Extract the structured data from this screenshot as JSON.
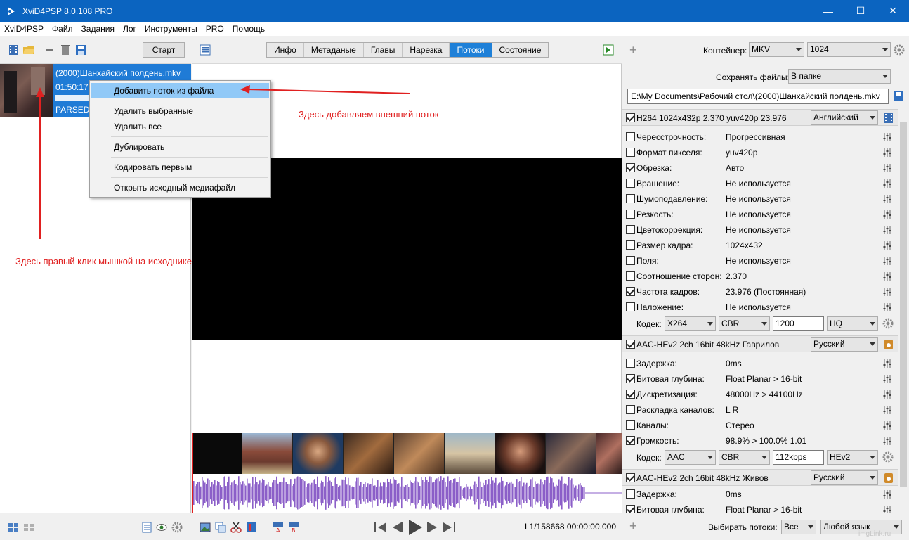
{
  "window": {
    "title": "XviD4PSP 8.0.108 PRO",
    "minimize": "—",
    "maximize": "☐",
    "close": "✕"
  },
  "menu": [
    "XviD4PSP",
    "Файл",
    "Задания",
    "Лог",
    "Инструменты",
    "PRO",
    "Помощь"
  ],
  "left": {
    "start_label": "Старт",
    "file": {
      "name": "(2000)Шанхайский полдень.mkv",
      "time": "01:50:17.",
      "status": "PARSED:"
    }
  },
  "context_menu": {
    "items": [
      "Добавить поток из файла",
      "Удалить выбранные",
      "Удалить все",
      "Дублировать",
      "Кодировать первым",
      "Открыть исходный медиафайл"
    ]
  },
  "center": {
    "tabs": [
      "Инфо",
      "Метаданые",
      "Главы",
      "Нарезка",
      "Потоки",
      "Состояние"
    ],
    "active_tab": "Потоки",
    "frame_counter": "I 1/158668 00:00:00.000"
  },
  "right": {
    "container_label": "Контейнер:",
    "container_value": "MKV",
    "container_option": "1024",
    "save_files_label": "Сохранять файлы:",
    "save_files_value": "В папке",
    "output_path": "E:\\My Documents\\Рабочий стол\\(2000)Шанхайский полдень.mkv",
    "video_stream": {
      "title": "H264 1024x432p 2.370 yuv420p 23.976",
      "language": "Английский",
      "props": [
        {
          "name": "Чересстрочность:",
          "value": "Прогрессивная",
          "checked": false
        },
        {
          "name": "Формат пикселя:",
          "value": "yuv420p",
          "checked": false
        },
        {
          "name": "Обрезка:",
          "value": "Авто",
          "checked": true
        },
        {
          "name": "Вращение:",
          "value": "Не используется",
          "checked": false
        },
        {
          "name": "Шумоподавление:",
          "value": "Не используется",
          "checked": false
        },
        {
          "name": "Резкость:",
          "value": "Не используется",
          "checked": false
        },
        {
          "name": "Цветокоррекция:",
          "value": "Не используется",
          "checked": false
        },
        {
          "name": "Размер кадра:",
          "value": "1024x432",
          "checked": false
        },
        {
          "name": "Поля:",
          "value": "Не используется",
          "checked": false
        },
        {
          "name": "Соотношение сторон:",
          "value": "2.370",
          "checked": false
        },
        {
          "name": "Частота кадров:",
          "value": "23.976 (Постоянная)",
          "checked": true
        },
        {
          "name": "Наложение:",
          "value": "Не используется",
          "checked": false
        }
      ],
      "codec_label": "Кодек:",
      "codec": "X264",
      "mode": "CBR",
      "bitrate": "1200",
      "preset": "HQ"
    },
    "audio_stream_1": {
      "title": "AAC-HEv2 2ch 16bit 48kHz Гаврилов",
      "language": "Русский",
      "props": [
        {
          "name": "Задержка:",
          "value": "0ms",
          "checked": false
        },
        {
          "name": "Битовая глубина:",
          "value": "Float Planar > 16-bit",
          "checked": true
        },
        {
          "name": "Дискретизация:",
          "value": "48000Hz > 44100Hz",
          "checked": true
        },
        {
          "name": "Раскладка каналов:",
          "value": "L R",
          "checked": false
        },
        {
          "name": "Каналы:",
          "value": "Стерео",
          "checked": false
        },
        {
          "name": "Громкость:",
          "value": "98.9% > 100.0% 1.01",
          "checked": true
        }
      ],
      "codec_label": "Кодек:",
      "codec": "AAC",
      "mode": "CBR",
      "bitrate": "112kbps",
      "preset": "HEv2"
    },
    "audio_stream_2": {
      "title": "AAC-HEv2 2ch 16bit 48kHz Живов",
      "language": "Русский",
      "props": [
        {
          "name": "Задержка:",
          "value": "0ms",
          "checked": false
        },
        {
          "name": "Битовая глубина:",
          "value": "Float Planar > 16-bit",
          "checked": true
        }
      ]
    },
    "bottom": {
      "plus": "+",
      "choose_streams_label": "Выбирать потоки:",
      "choose_streams_value": "Все",
      "language_value": "Любой язык"
    }
  },
  "annotations": {
    "right_click": "Здесь правый клик мышкой на исходнике",
    "add_external": "Здесь добавляем внешний поток"
  },
  "colors": {
    "titlebar": "#0b64c0",
    "selection": "#1f7bd6",
    "annotation": "#e02020",
    "waveform": "#8b5fc8"
  },
  "watermark": "imgLink.ru"
}
